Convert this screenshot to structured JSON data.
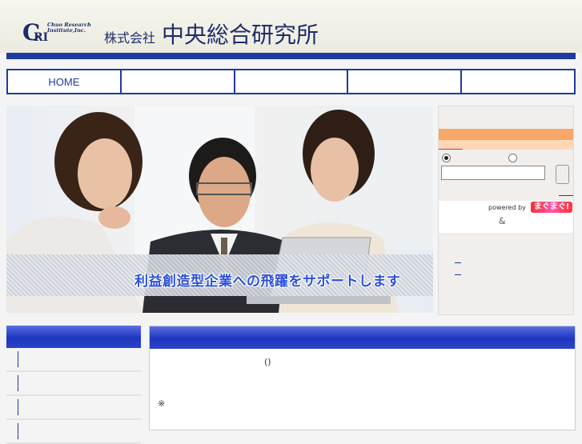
{
  "header": {
    "logo_text": "CRI",
    "logo_subtitle_line1": "Chuo Research",
    "logo_subtitle_line2": "Institute,Inc.",
    "company_prefix": "株式会社",
    "company_name": "中央総合研究所"
  },
  "nav": {
    "items": [
      {
        "label": "HOME"
      },
      {
        "label": ""
      },
      {
        "label": ""
      },
      {
        "label": ""
      },
      {
        "label": ""
      }
    ]
  },
  "hero": {
    "banner_text": "利益創造型企業への飛躍をサポートします"
  },
  "sidebar": {
    "powered_by": "powered by",
    "powered_brand": "まぐまぐ!",
    "ampersand": "&"
  },
  "main": {
    "paren": "()",
    "note_mark": "※"
  },
  "colors": {
    "brand_blue": "#1f3aa0",
    "accent_orange": "#f7a768"
  }
}
